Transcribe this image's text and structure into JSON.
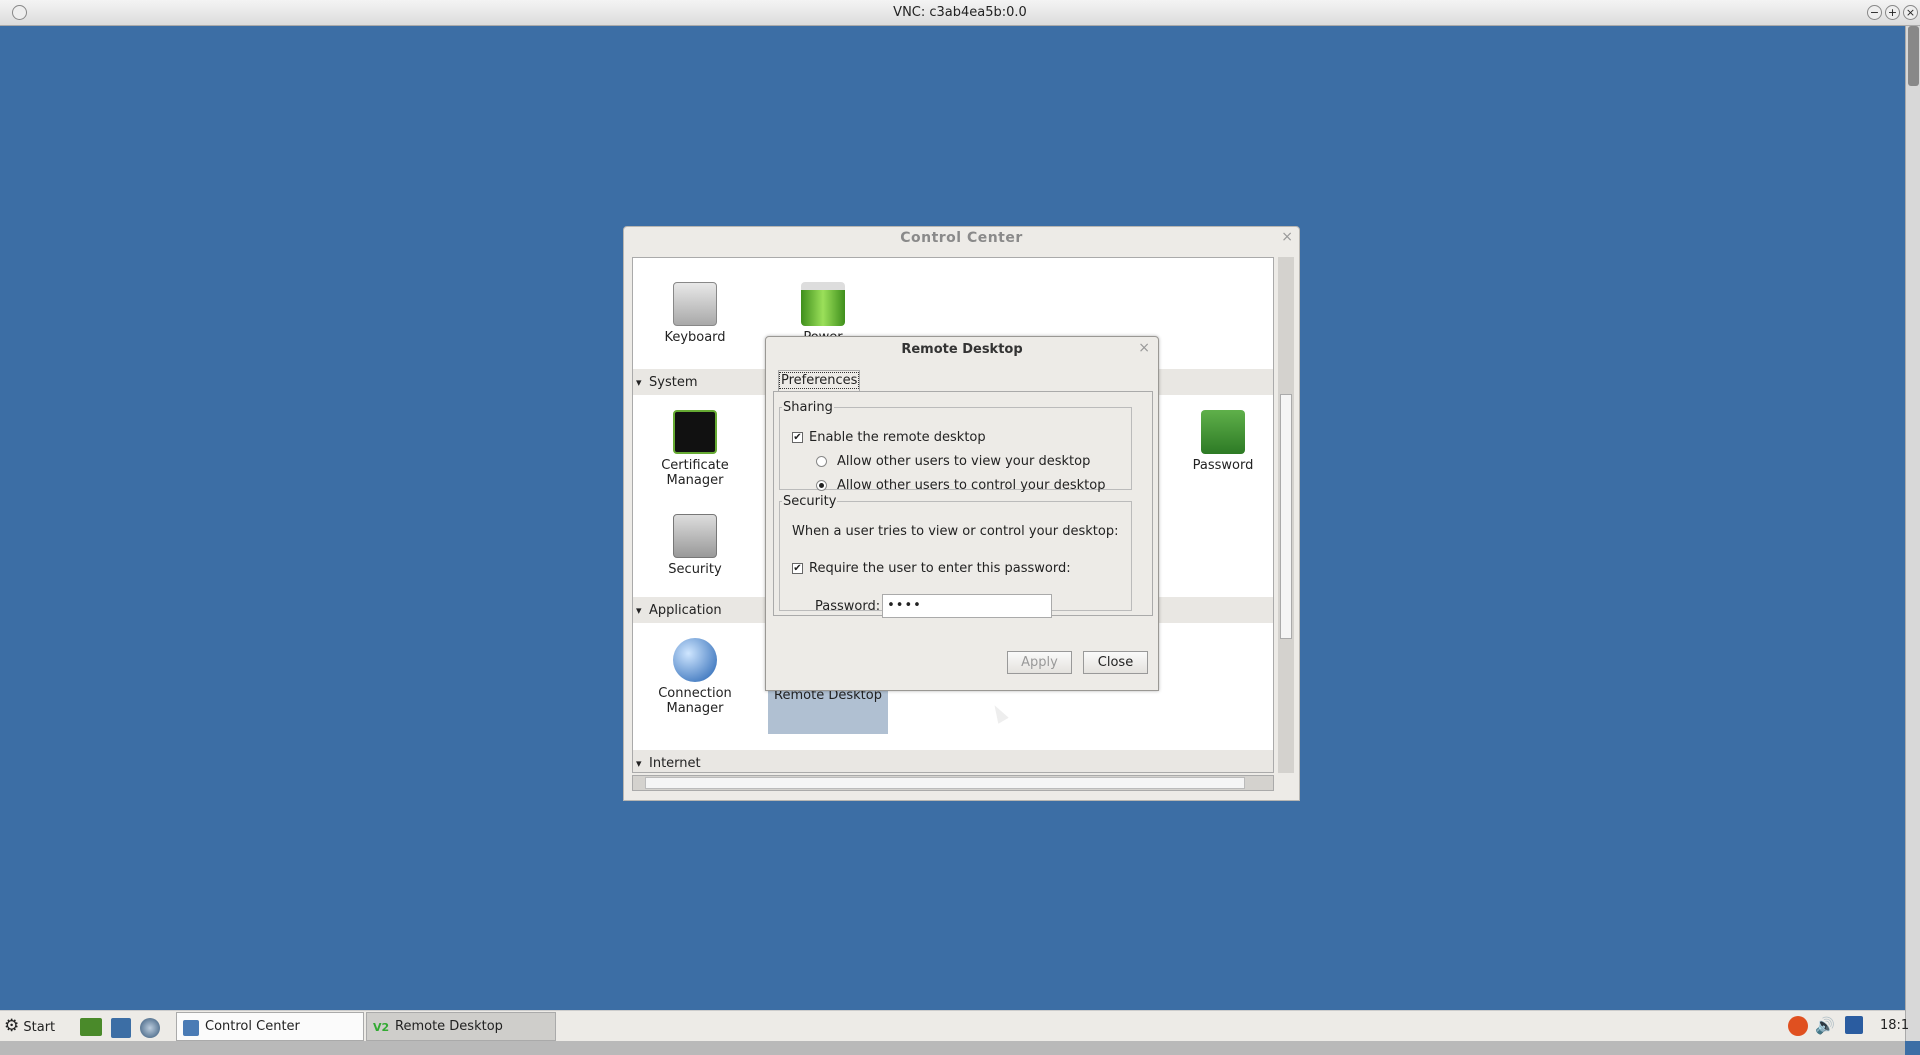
{
  "vnc": {
    "title": "VNC: c3ab4ea5b:0.0"
  },
  "control_center": {
    "title": "Control Center",
    "sections": [
      {
        "label": "System"
      },
      {
        "label": "Application"
      },
      {
        "label": "Internet"
      }
    ],
    "items": {
      "keyboard": "Keyboard",
      "power": "Power Manager",
      "certificate": "Certificate Manager",
      "security": "Security",
      "password": "Password",
      "connection": "Connection Manager",
      "remote": "Remote Desktop"
    }
  },
  "remote_desktop": {
    "title": "Remote Desktop",
    "tab": "Preferences",
    "sharing": {
      "legend": "Sharing",
      "enable_label": "Enable the remote desktop",
      "enable_checked": true,
      "view_label": "Allow other users to view your desktop",
      "control_label": "Allow other users to control your desktop",
      "selected": "control"
    },
    "security": {
      "legend": "Security",
      "desc": "When a user tries to view or control your desktop:",
      "require_label": "Require the user to enter this password:",
      "require_checked": true,
      "password_label": "Password:",
      "password_value": "••••"
    },
    "apply_label": "Apply",
    "close_label": "Close"
  },
  "taskbar": {
    "start": "Start",
    "tasks": [
      {
        "label": "Control Center"
      },
      {
        "label": "Remote Desktop"
      }
    ],
    "clock": "18:1"
  }
}
